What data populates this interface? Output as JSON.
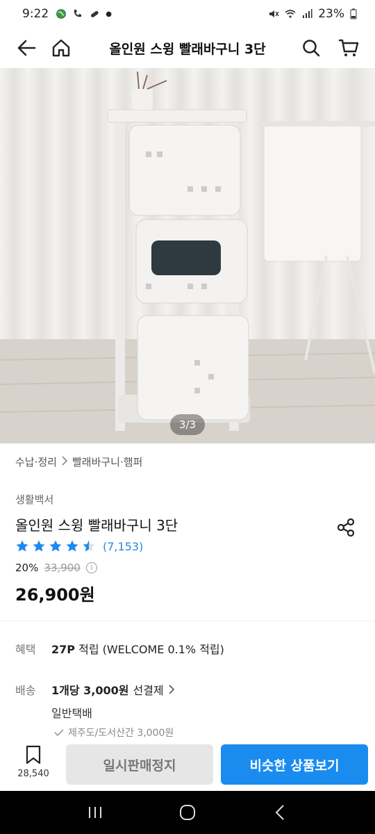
{
  "status_bar": {
    "time": "9:22",
    "battery": "23%"
  },
  "nav": {
    "title": "올인원 스윙 빨래바구니 3단",
    "icons": [
      "back-arrow-icon",
      "home-icon",
      "search-icon",
      "cart-icon"
    ]
  },
  "gallery": {
    "counter": "3/3"
  },
  "breadcrumb": {
    "level1": "수납·정리",
    "level2": "빨래바구니·햄퍼"
  },
  "product": {
    "brand": "생활백서",
    "name": "올인원 스윙 빨래바구니 3단",
    "rating": 4.5,
    "review_count": "(7,153)",
    "discount": "20%",
    "original_price": "33,900",
    "price": "26,900원"
  },
  "benefit": {
    "label": "혜택",
    "points": "27P",
    "text": "적립 (WELCOME 0.1% 적립)"
  },
  "shipping": {
    "label": "배송",
    "fee": "1개당 3,000원",
    "fee_suffix": "선결제",
    "method": "일반택배",
    "note": "제주도/도서산간 3,000원"
  },
  "actions": {
    "wish_count": "28,540",
    "pause_label": "일시판매정지",
    "similar_label": "비슷한 상품보기"
  },
  "colors": {
    "accent": "#1a8cf0",
    "star": "#1a8cf0"
  }
}
